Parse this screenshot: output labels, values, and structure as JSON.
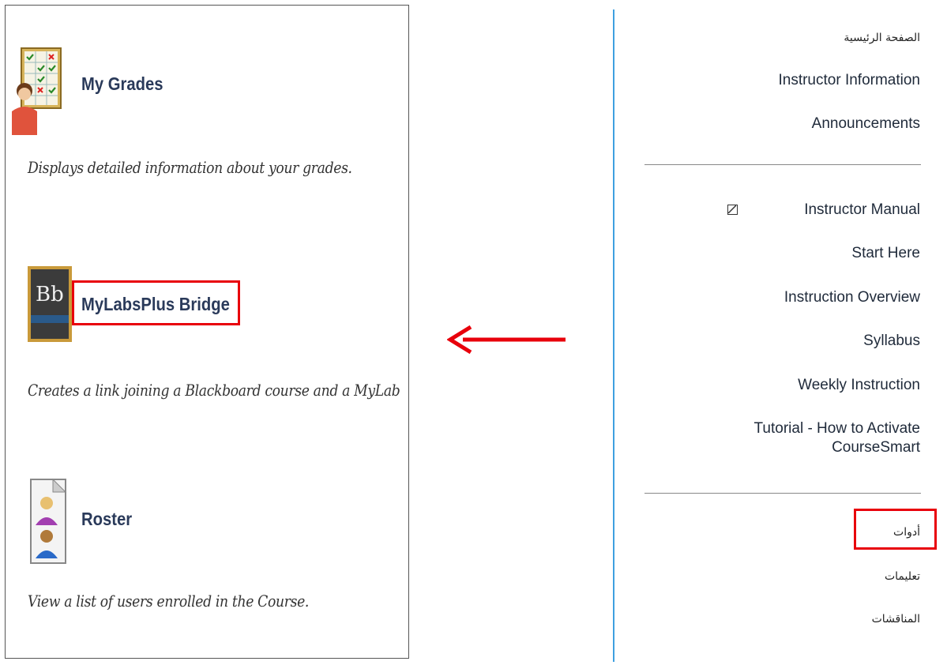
{
  "tools": [
    {
      "title": "My Grades",
      "description": "Displays detailed information about your grades.",
      "icon": "grades-icon"
    },
    {
      "title": "MyLabsPlus Bridge",
      "description": "Creates a link joining a Blackboard course and a MyLab",
      "icon": "blackboard-bb-icon",
      "icon_text": "Bb"
    },
    {
      "title": "Roster",
      "description": "View a list of users enrolled in the Course.",
      "icon": "roster-icon"
    }
  ],
  "course_menu": {
    "home": "الصفحة الرئيسية",
    "instructor_information": "Instructor Information",
    "announcements": "Announcements",
    "instructor_manual": "Instructor Manual",
    "start_here": "Start Here",
    "instruction_overview": "Instruction Overview",
    "syllabus": "Syllabus",
    "weekly_instruction": "Weekly Instruction",
    "tutorial_line1": "Tutorial - How to Activate",
    "tutorial_line2": "CourseSmart",
    "tools": "أدوات",
    "help": "تعليمات",
    "discussions": "المناقشات"
  },
  "colors": {
    "highlight": "#e8000b",
    "menu_divider": "#3ea0e0",
    "title_text": "#2a3a5a"
  }
}
